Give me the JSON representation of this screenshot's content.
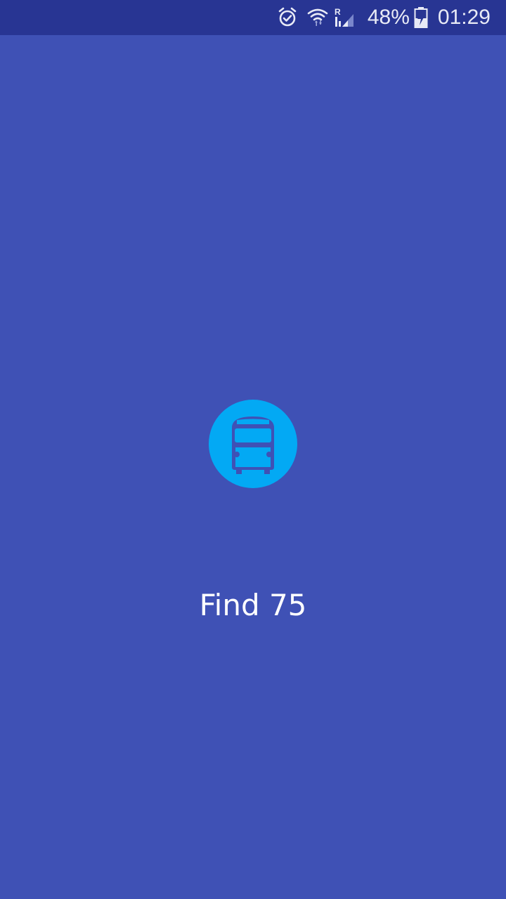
{
  "status_bar": {
    "battery_percent": "48%",
    "time": "01:29",
    "network_badge": "R",
    "icons": [
      "alarm-icon",
      "wifi-icon",
      "signal-icon",
      "battery-charging-icon"
    ]
  },
  "splash": {
    "app_name": "Find 75",
    "logo_icon": "bus-icon"
  },
  "colors": {
    "background": "#3f51b5",
    "status_bar": "#283593",
    "logo_circle": "#03a9f4",
    "text": "#ffffff"
  }
}
